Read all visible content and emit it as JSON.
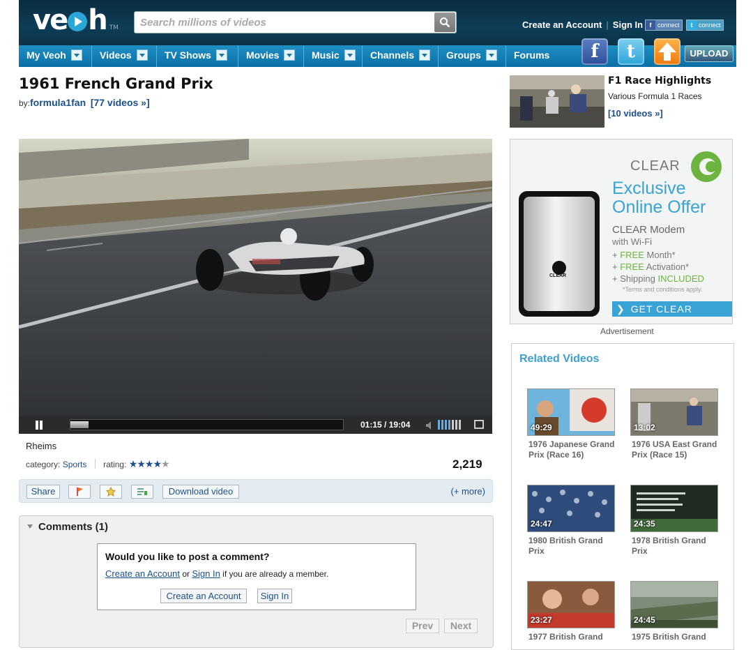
{
  "header": {
    "logo_text": "veoh",
    "logo_tm": "TM",
    "search_placeholder": "Search millions of videos",
    "create_account": "Create an Account",
    "sign_in": "Sign In",
    "fb_connect": "connect",
    "tw_connect": "connect",
    "upload": "UPLOAD"
  },
  "nav": {
    "items": [
      "My Veoh",
      "Videos",
      "TV Shows",
      "Movies",
      "Music",
      "Channels",
      "Groups",
      "Forums"
    ]
  },
  "video": {
    "title": "1961 French Grand Prix",
    "by_label": "by:",
    "author": "formula1fan",
    "author_videos": "[77 videos »]",
    "timecode": "01:15 / 19:04",
    "progress_fraction": 0.066,
    "location": "Rheims",
    "category_label": "category:",
    "category": "Sports",
    "rating_label": "rating:",
    "rating": 4,
    "rating_max": 5,
    "views": "2,219"
  },
  "actions": {
    "share": "Share",
    "download": "Download video",
    "more": "(+ more)"
  },
  "comments": {
    "heading": "Comments (1)",
    "question": "Would you like to post a comment?",
    "create_link": "Create an Account",
    "or_text": "or",
    "signin_link": "Sign In",
    "member_text": "if you are already a member.",
    "create_btn": "Create an Account",
    "signin_btn": "Sign In",
    "prev": "Prev",
    "next": "Next"
  },
  "sidebar": {
    "playlist_title": "F1 Race Highlights",
    "playlist_sub": "Various Formula 1 Races",
    "playlist_count": "[10 videos »]",
    "ad": {
      "brand": "CLEAR",
      "headline1": "Exclusive",
      "headline2": "Online Offer",
      "product1": "CLEAR Modem",
      "product2": "with Wi-Fi",
      "perk1_a": "FREE",
      "perk1_b": "Month*",
      "perk2_a": "FREE",
      "perk2_b": "Activation*",
      "perk3_a": "Shipping",
      "perk3_b": "INCLUDED",
      "terms": "*Terms and conditions apply.",
      "cta": "GET CLEAR",
      "device_label": "CLEAR"
    },
    "ad_label": "Advertisement",
    "related_heading": "Related Videos",
    "related": [
      {
        "duration": "49:29",
        "title": "1976 Japanese Grand Prix (Race 16)"
      },
      {
        "duration": "13:02",
        "title": "1976 USA East Grand Prix (Race 15)"
      },
      {
        "duration": "24:47",
        "title": "1980 British Grand Prix"
      },
      {
        "duration": "24:35",
        "title": "1978 British Grand Prix"
      },
      {
        "duration": "23:27",
        "title": "1977 British Grand"
      },
      {
        "duration": "24:45",
        "title": "1975 British Grand"
      }
    ]
  },
  "colors": {
    "header_bg": "#0d3d57",
    "nav_bg": "#1e8fc4",
    "link": "#1b4f8a",
    "accent": "#3ea0d0",
    "ad_green": "#6cb33f",
    "ad_blue": "#39a3d6"
  }
}
